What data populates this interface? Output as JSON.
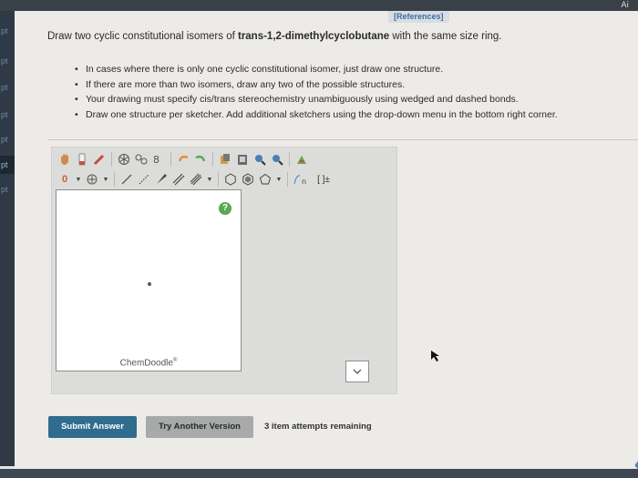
{
  "topbar": {
    "right_label": "Ai"
  },
  "sidebar": {
    "items": [
      {
        "label": "pt"
      },
      {
        "label": "pt"
      },
      {
        "label": "pt"
      },
      {
        "label": "pt"
      },
      {
        "label": "pt"
      },
      {
        "label": "pt"
      },
      {
        "label": "pt"
      }
    ]
  },
  "references": "[References]",
  "question": {
    "prefix": "Draw two cyclic constitutional isomers of ",
    "compound": "trans-1,2-dimethylcyclobutane",
    "suffix": " with the same size ring."
  },
  "instructions": [
    "In cases where there is only one cyclic constitutional isomer, just draw one structure.",
    "If there are more than two isomers, draw any two of the possible structures.",
    "Your drawing must specify cis/trans stereochemistry unambiguously using wedged and dashed bonds.",
    "Draw one structure per sketcher. Add additional sketchers using the drop-down menu in the bottom right corner."
  ],
  "sketcher": {
    "brand": "ChemDoodle",
    "brand_mark": "®",
    "help": "?",
    "toolbar_row1": [
      "hand-tool",
      "eraser-tool",
      "lasso-tool",
      "ring-template-tool",
      "chain-tool",
      "undo-tool",
      "redo-tool",
      "copy-tool",
      "paste-tool",
      "zoom-in-tool",
      "zoom-out-tool",
      "clean-tool"
    ],
    "toolbar_row2": [
      "charge-tool",
      "atom-add-tool",
      "single-bond-tool",
      "dashed-bond-tool",
      "wedge-bond-tool",
      "double-bond-tool",
      "triple-bond-tool",
      "hexagon-tool",
      "cyclopentane-tool",
      "pentagon-tool",
      "repeat-unit-tool",
      "bracket-tool"
    ],
    "charge_label": "0",
    "repeat_label": "n",
    "bracket_label": "[ ]±"
  },
  "buttons": {
    "submit": "Submit Answer",
    "try_another": "Try Another Version"
  },
  "attempts": "3 item attempts remaining",
  "colors": {
    "submit": "#2f6c8e",
    "link": "#3b6ea5",
    "help": "#58a858"
  }
}
